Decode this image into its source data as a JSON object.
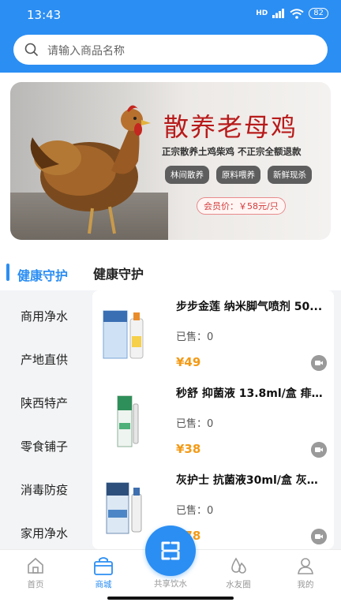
{
  "status_bar": {
    "time": "13:43",
    "network": "HD",
    "battery": "82"
  },
  "search": {
    "placeholder": "请输入商品名称"
  },
  "banner": {
    "title": "散养老母鸡",
    "subtitle": "正宗散养土鸡柴鸡  不正宗全额退款",
    "tags": [
      "林间散养",
      "原料喂养",
      "新鲜现杀"
    ],
    "price_label": "会员价：￥58元/只"
  },
  "category": {
    "active_left": "健康守护",
    "right_title": "健康守护",
    "sidebar": [
      "商用净水",
      "产地直供",
      "陕西特产",
      "零食铺子",
      "消毒防疫",
      "家用净水"
    ]
  },
  "products": [
    {
      "name": "步步金莲 纳米脚气喷剂 50...",
      "sold": "已售：0",
      "price": "¥49"
    },
    {
      "name": "秒舒 抑菌液 13.8ml/盒 痱子...",
      "sold": "已售：0",
      "price": "¥38"
    },
    {
      "name": "灰护士 抗菌液30ml/盒 灰指...",
      "sold": "已售：0",
      "price": "¥78"
    }
  ],
  "tabbar": {
    "items": [
      {
        "label": "首页",
        "icon": "home-icon"
      },
      {
        "label": "商城",
        "icon": "shop-bag-icon"
      },
      {
        "label": "共享饮水",
        "icon": "scan-icon"
      },
      {
        "label": "水友圈",
        "icon": "water-drops-icon"
      },
      {
        "label": "我的",
        "icon": "user-icon"
      }
    ],
    "active": "商城"
  },
  "colors": {
    "primary": "#2b8ef3",
    "price": "#f39a16",
    "banner_title": "#b81b1b"
  }
}
